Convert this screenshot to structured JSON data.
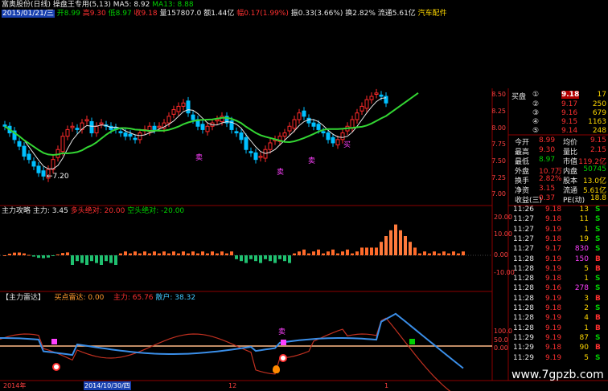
{
  "header": {
    "line1": "富奥股份(日线) 操盘王专用(5,13) MA5: 8.92",
    "ma13": "MA13: 8.88",
    "line2_date": "2015/01/21/三",
    "open": "开8.99",
    "high": "高9.30",
    "low": "低8.97",
    "close": "收9.18",
    "volume": "量157807.0",
    "amount": "额1.44亿",
    "change": "幅0.17(1.99%)",
    "amp": "振0.33(3.66%)",
    "turnover": "换2.82%",
    "float": "流通5.61亿",
    "sector": "汽车配件"
  },
  "main_chart": {
    "price_ticks": [
      "8.50",
      "8.25",
      "8.00",
      "7.75",
      "7.50",
      "7.25",
      "7.00"
    ],
    "low_label": "←7.20",
    "marks": [
      {
        "text": "卖",
        "color": "#ff40ff"
      },
      {
        "text": "卖",
        "color": "#ff40ff"
      },
      {
        "text": "卖",
        "color": "#ff40ff"
      },
      {
        "text": "买",
        "color": "#ff40ff"
      }
    ]
  },
  "panel2": {
    "title": "主力攻略",
    "main_label": "主力: 3.45",
    "long_label": "多头绝对: 20.00",
    "short_label": "空头绝对: -20.00",
    "ticks": [
      "20.00",
      "10.00",
      "0.00",
      "-10.00"
    ]
  },
  "panel3": {
    "title": "【主力雷达】",
    "buy_label": "买点雷达: 0.00",
    "main_label": "主力: 65.76",
    "retail_label": "散户: 38.32",
    "ticks": [
      "100.0",
      "50.0",
      "0.00"
    ],
    "marks": [
      {
        "text": "卖",
        "color": "#ff40ff"
      },
      {
        "text": "卖",
        "color": "#ff40ff"
      }
    ]
  },
  "x_axis": {
    "label_left": "2014年",
    "label_date": "2014/10/30/四",
    "label_12": "12",
    "label_1": "1"
  },
  "quote": {
    "title": "买盘",
    "levels": [
      {
        "idx": "①",
        "price": "9.18",
        "vol": "17"
      },
      {
        "idx": "②",
        "price": "9.17",
        "vol": "250"
      },
      {
        "idx": "③",
        "price": "9.16",
        "vol": "679"
      },
      {
        "idx": "④",
        "price": "9.15",
        "vol": "1163"
      },
      {
        "idx": "⑤",
        "price": "9.14",
        "vol": "248"
      }
    ],
    "stats": [
      {
        "l1": "今开",
        "v1": "8.99",
        "l2": "均价",
        "v2": "9.15"
      },
      {
        "l1": "最高",
        "v1": "9.30",
        "l2": "量比",
        "v2": "2.15"
      },
      {
        "l1": "最低",
        "v1": "8.97",
        "l2": "市值",
        "v2": "119.2亿"
      },
      {
        "l1": "外盘",
        "v1": "10.7万",
        "l2": "内盘",
        "v2": "50745"
      },
      {
        "l1": "换手",
        "v1": "2.82%",
        "l2": "股本",
        "v2": "13.0亿"
      },
      {
        "l1": "净资",
        "v1": "3.15",
        "l2": "流通",
        "v2": "5.61亿"
      },
      {
        "l1": "收益(三)",
        "v1": "0.37",
        "l2": "PE(动)",
        "v2": "18.8"
      }
    ]
  },
  "trades": [
    {
      "time": "11:26",
      "price": "9.18",
      "vol": "13",
      "side": "S"
    },
    {
      "time": "11:27",
      "price": "9.18",
      "vol": "11",
      "side": "S"
    },
    {
      "time": "11:27",
      "price": "9.19",
      "vol": "1",
      "side": "S"
    },
    {
      "time": "11:27",
      "price": "9.18",
      "vol": "19",
      "side": "S"
    },
    {
      "time": "11:27",
      "price": "9.17",
      "vol": "830",
      "side": "S"
    },
    {
      "time": "11:28",
      "price": "9.19",
      "vol": "150",
      "side": "B"
    },
    {
      "time": "11:28",
      "price": "9.19",
      "vol": "5",
      "side": "B"
    },
    {
      "time": "11:28",
      "price": "9.18",
      "vol": "1",
      "side": "S"
    },
    {
      "time": "11:28",
      "price": "9.16",
      "vol": "278",
      "side": "S"
    },
    {
      "time": "11:28",
      "price": "9.19",
      "vol": "3",
      "side": "B"
    },
    {
      "time": "11:28",
      "price": "9.18",
      "vol": "2",
      "side": "S"
    },
    {
      "time": "11:28",
      "price": "9.19",
      "vol": "4",
      "side": "B"
    },
    {
      "time": "11:28",
      "price": "9.19",
      "vol": "1",
      "side": "B"
    },
    {
      "time": "11:29",
      "price": "9.19",
      "vol": "87",
      "side": "S"
    },
    {
      "time": "11:29",
      "price": "9.18",
      "vol": "90",
      "side": "B"
    },
    {
      "time": "11:29",
      "price": "9.19",
      "vol": "5",
      "side": "S"
    }
  ],
  "watermark": "www.7gpzb.com"
}
